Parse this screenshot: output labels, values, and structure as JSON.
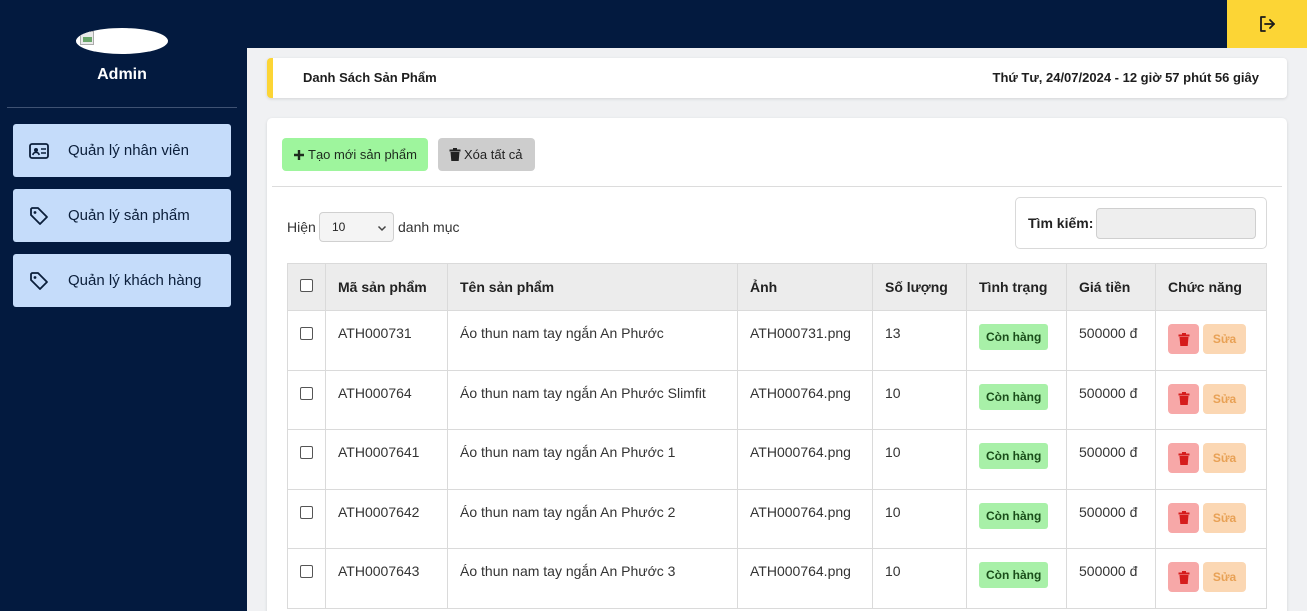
{
  "sidebar": {
    "admin_name": "Admin",
    "items": [
      {
        "label": "Quản lý nhân viên",
        "icon": "id-card-icon"
      },
      {
        "label": "Quản lý sản phẩm",
        "icon": "tag-icon"
      },
      {
        "label": "Quản lý khách hàng",
        "icon": "tag-icon"
      }
    ]
  },
  "header": {
    "page_title": "Danh Sách Sản Phẩm",
    "datetime": "Thứ Tư, 24/07/2024 - 12 giờ 57 phút 56 giây",
    "logout_icon": "logout-icon",
    "accent_color": "#fcd535"
  },
  "toolbar": {
    "create_label": "Tạo mới sản phẩm",
    "clear_label": "Xóa tất cả"
  },
  "list_controls": {
    "show_label": "Hiện",
    "page_size": "10",
    "entries_label": "danh mục",
    "search_label": "Tìm kiếm:",
    "search_value": ""
  },
  "table": {
    "columns": [
      "Mã sản phẩm",
      "Tên sản phẩm",
      "Ảnh",
      "Số lượng",
      "Tình trạng",
      "Giá tiền",
      "Chức năng"
    ],
    "edit_label": "Sửa",
    "rows": [
      {
        "code": "ATH000731",
        "name": "Áo thun nam tay ngắn An Phước",
        "image": "ATH000731.png",
        "qty": "13",
        "status": "Còn hàng",
        "price": "500000 đ"
      },
      {
        "code": "ATH000764",
        "name": "Áo thun nam tay ngắn An Phước Slimfit",
        "image": "ATH000764.png",
        "qty": "10",
        "status": "Còn hàng",
        "price": "500000 đ"
      },
      {
        "code": "ATH0007641",
        "name": "Áo thun nam tay ngắn An Phước 1",
        "image": "ATH000764.png",
        "qty": "10",
        "status": "Còn hàng",
        "price": "500000 đ"
      },
      {
        "code": "ATH0007642",
        "name": "Áo thun nam tay ngắn An Phước 2",
        "image": "ATH000764.png",
        "qty": "10",
        "status": "Còn hàng",
        "price": "500000 đ"
      },
      {
        "code": "ATH0007643",
        "name": "Áo thun nam tay ngắn An Phước 3",
        "image": "ATH000764.png",
        "qty": "10",
        "status": "Còn hàng",
        "price": "500000 đ"
      }
    ]
  }
}
